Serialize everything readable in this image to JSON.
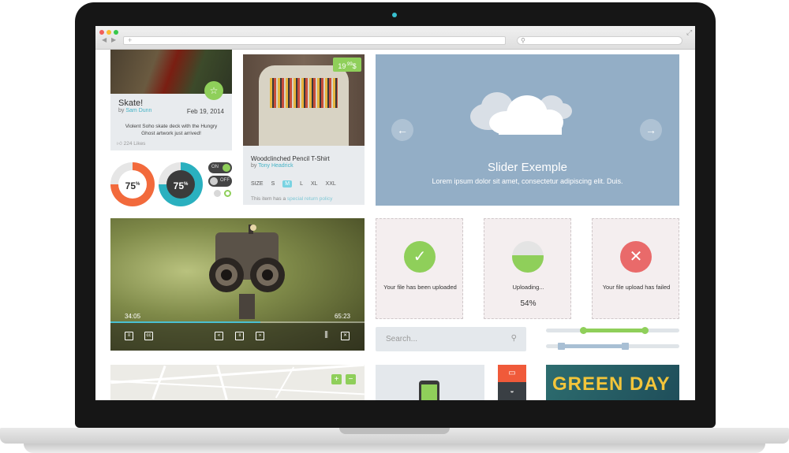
{
  "browser": {
    "address": "+",
    "search": "⚲",
    "expand_icon": "⤢"
  },
  "card_skate": {
    "title": "Skate!",
    "by_prefix": "by",
    "author": "Sam Dunn",
    "date": "Feb 19, 2014",
    "description": "Violent Soho skate deck with the Hungry Ghost artwork just arrived!",
    "likes": "224 Likes"
  },
  "donuts": [
    {
      "value_label": "75",
      "unit": "%",
      "value": 75,
      "color": "#f26a3c"
    },
    {
      "value_label": "75",
      "unit": "%",
      "value": 75,
      "color": "#2ab0bf"
    }
  ],
  "toggles": {
    "on_label": "ON",
    "off_label": "OFF"
  },
  "tshirt": {
    "price": "19",
    "price_cents": ".99",
    "currency": "$",
    "title": "Woodclinched Pencil T-Shirt",
    "by_prefix": "by",
    "author": "Tony Headrick",
    "size_label": "SIZE",
    "sizes": [
      "S",
      "M",
      "L",
      "XL",
      "XXL"
    ],
    "selected_size": "M",
    "note_prefix": "This item has a",
    "note_link": "special return policy"
  },
  "slider": {
    "title": "Slider Exemple",
    "subtitle": "Lorem ipsum dolor sit amet, consectetur adipiscing elit. Duis.",
    "prev_icon": "←",
    "next_icon": "→"
  },
  "video": {
    "current_time": "34:05",
    "total_time": "65:23",
    "progress": 0.59
  },
  "uploads": [
    {
      "text": "Your file has been uploaded",
      "status": "success",
      "color": "#8fcf5a",
      "icon": "✓"
    },
    {
      "text": "Uploading...",
      "percent": "54%",
      "status": "uploading",
      "color": "#8fcf5a"
    },
    {
      "text": "Your file upload has failed",
      "status": "failed",
      "color": "#e96a6a",
      "icon": "✕"
    }
  ],
  "search": {
    "placeholder": "Search..."
  },
  "range_sliders": [
    {
      "low": 0.28,
      "high": 0.74,
      "color": "#8fcf5a"
    },
    {
      "low": 0.11,
      "high": 0.59,
      "color": "#a8bfd4"
    }
  ],
  "map": {
    "zoom_in": "+",
    "zoom_out": "−"
  },
  "album": {
    "text": "GREEN DAY"
  }
}
